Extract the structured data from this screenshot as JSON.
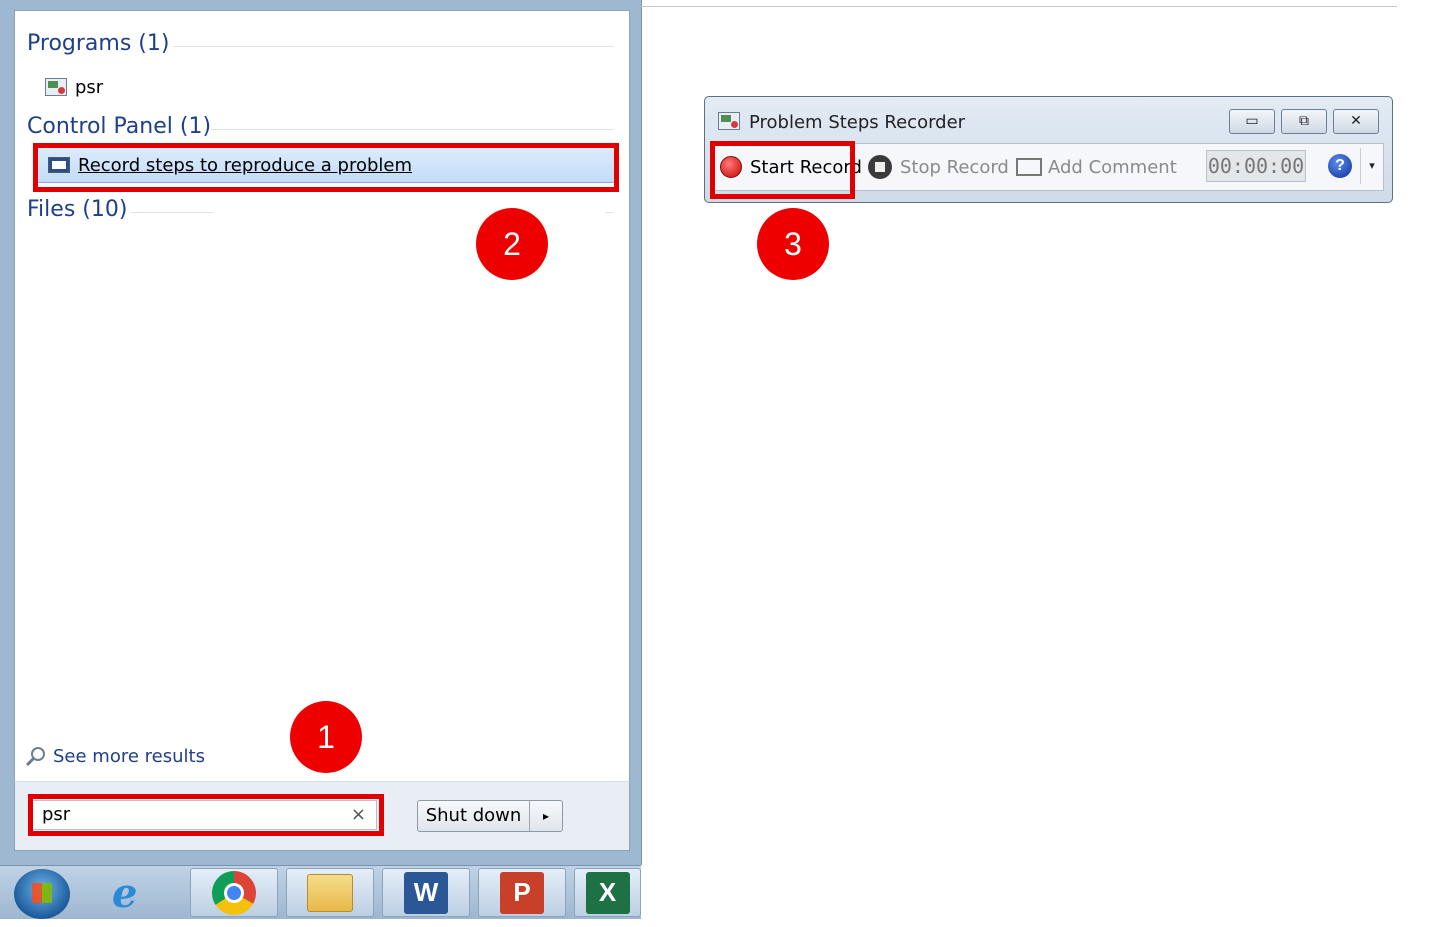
{
  "start_menu": {
    "programs_header": "Programs (1)",
    "program_item": "psr",
    "control_panel_header": "Control Panel (1)",
    "control_panel_item": "Record steps to reproduce a problem",
    "files_header": "Files (10)",
    "see_more": "See more results",
    "search_value": "psr",
    "search_clear": "×",
    "shutdown_label": "Shut down",
    "shutdown_arrow": "▸"
  },
  "psr_window": {
    "title": "Problem Steps Recorder",
    "minimize": "▭",
    "restore": "⧉",
    "close": "✕",
    "start_record": "Start Record",
    "stop_record": "Stop Record",
    "add_comment": "Add Comment",
    "timer": "00:00:00",
    "help": "?",
    "dropdown": "▾"
  },
  "taskbar": {
    "items": [
      "windows-orb",
      "internet-explorer-icon",
      "chrome-icon",
      "file-explorer-icon",
      "word-icon",
      "powerpoint-icon",
      "excel-icon"
    ],
    "word_letter": "W",
    "powerpoint_letter": "P",
    "excel_letter": "X"
  },
  "annotations": {
    "step1": "1",
    "step2": "2",
    "step3": "3",
    "highlight_color": "#e00000"
  }
}
